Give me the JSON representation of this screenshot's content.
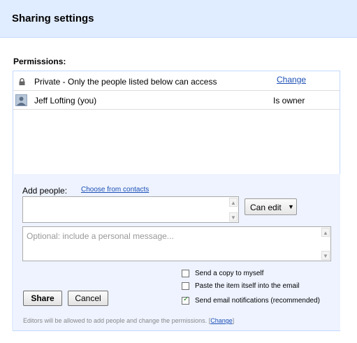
{
  "window": {
    "title": "Sharing settings"
  },
  "permissions": {
    "label": "Permissions:",
    "visibility": {
      "text": "Private - Only the people listed below can access",
      "change_link": "Change"
    },
    "people": [
      {
        "name": "Jeff Lofting (you)",
        "role": "Is owner"
      }
    ]
  },
  "add_people": {
    "label": "Add people:",
    "contacts_link": "Choose from contacts",
    "input_value": "",
    "permission_dropdown": "Can edit",
    "message_placeholder": "Optional: include a personal message..."
  },
  "options": [
    {
      "label": "Send a copy to myself",
      "checked": false
    },
    {
      "label": "Paste the item itself into the email",
      "checked": false
    },
    {
      "label": "Send email notifications (recommended)",
      "checked": true
    }
  ],
  "buttons": {
    "share": "Share",
    "cancel": "Cancel"
  },
  "footer": {
    "note_prefix": "Editors will be allowed to add people and change the permissions.",
    "note_open": "[",
    "note_link": "Change",
    "note_close": "]"
  },
  "colors": {
    "titlebar": "#e0ecff",
    "panel_border": "#c3d9ff",
    "add_area": "#eef3ff",
    "link": "#1c4fb5"
  },
  "icons": {
    "lock": "lock-icon",
    "avatar": "user-avatar",
    "dropdown": "chevron-down-icon"
  }
}
